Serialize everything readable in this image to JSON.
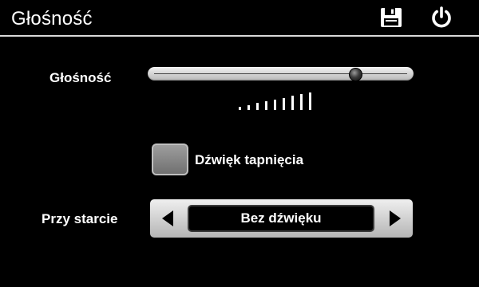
{
  "header": {
    "title": "Głośność",
    "save_icon": "floppy-disk-icon",
    "power_icon": "power-icon"
  },
  "volume": {
    "label": "Głośność",
    "level": 0.8,
    "bar_count": 9
  },
  "tap_sound": {
    "label": "Dźwięk tapnięcia",
    "checked": false
  },
  "startup": {
    "label": "Przy starcie",
    "value": "Bez dźwięku",
    "prev_icon": "triangle-left-icon",
    "next_icon": "triangle-right-icon"
  },
  "colors": {
    "background": "#000000",
    "text": "#ffffff",
    "control_light": "#d7d7d7"
  }
}
